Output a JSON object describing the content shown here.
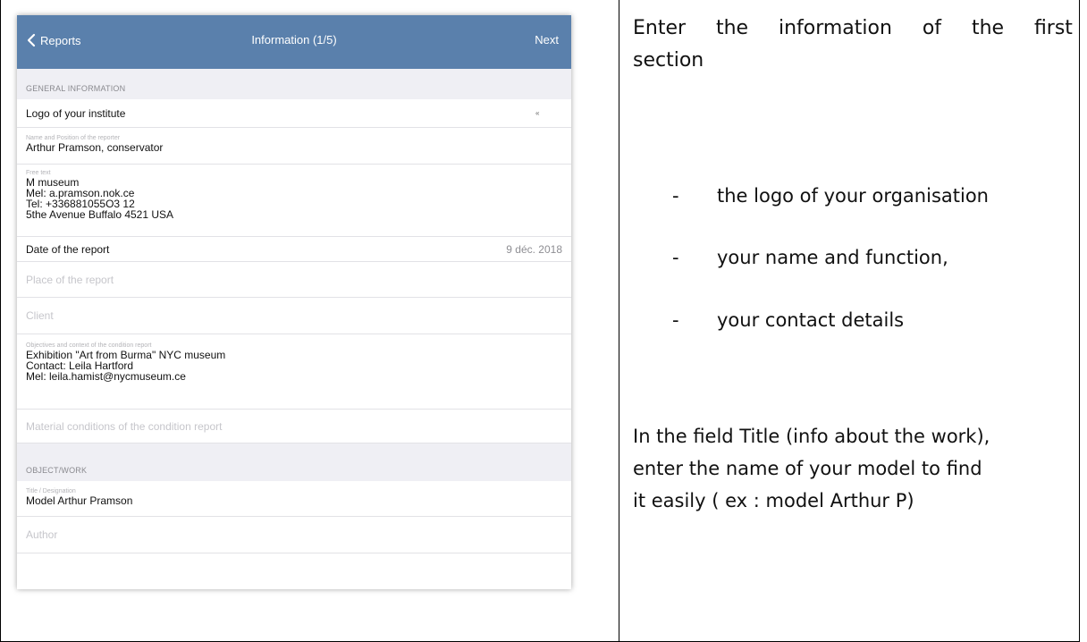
{
  "screen": {
    "nav": {
      "back_label": "Reports",
      "title": "Information (1/5)",
      "next_label": "Next"
    },
    "general_section": "GENERAL INFORMATION",
    "logo_row": {
      "label": "Logo of your institute",
      "thumb": "«"
    },
    "name_row": {
      "small_label": "Name and Position of the reporter",
      "value": "Arthur Pramson, conservator"
    },
    "free_text_row": {
      "small_label": "Free text",
      "lines": [
        "M museum",
        "Mel: a.pramson.nok.ce",
        "Tel: +336881055O3 12",
        "5the Avenue Buffalo 4521 USA"
      ]
    },
    "date_row": {
      "label": "Date of the report",
      "value": "9 déc. 2018"
    },
    "place_row": {
      "placeholder": "Place of the report"
    },
    "client_row": {
      "placeholder": "Client"
    },
    "objectives_row": {
      "small_label": "Objectives and context of the condition report",
      "lines": [
        "Exhibition \"Art from Burma\" NYC museum",
        "Contact: Leila Hartford",
        "Mel: leila.hamist@nycmuseum.ce"
      ]
    },
    "material_row": {
      "placeholder": "Material conditions of the condition report"
    },
    "object_section": "OBJECT/WORK",
    "title_row": {
      "small_label": "Title / Designation",
      "value": "Model Arthur Pramson"
    },
    "author_row": {
      "placeholder": "Author"
    }
  },
  "instructions": {
    "intro_line1_words": [
      "Enter",
      "the",
      "information",
      "of",
      "the",
      "first"
    ],
    "intro_line2": "section",
    "bullets": [
      "the logo of your organisation",
      "your name and function,",
      "your contact details"
    ],
    "bullet_dash": "-",
    "title_para_lines": [
      "In the field Title (info about the work),",
      "enter the name of your  model to find",
      "it easily ( ex : model Arthur P)"
    ]
  },
  "colors": {
    "navbar": "#5a80ac",
    "section_bg": "#efeff4"
  }
}
